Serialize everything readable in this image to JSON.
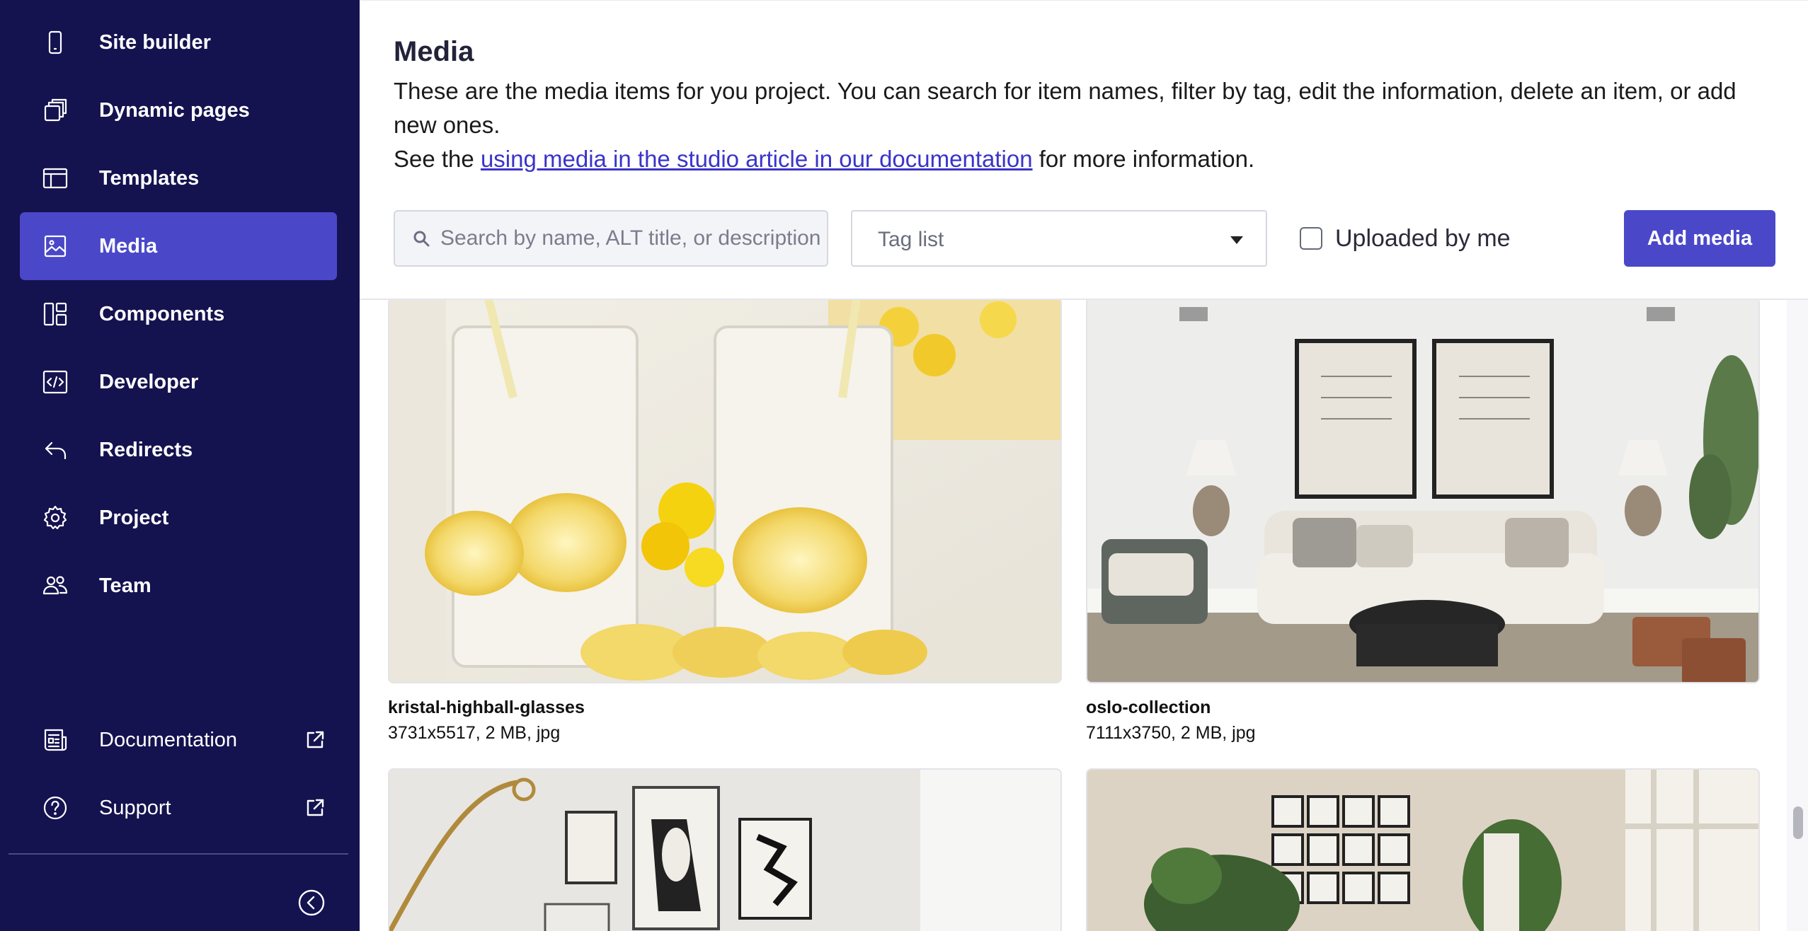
{
  "sidebar": {
    "items": [
      {
        "label": "Site builder",
        "icon": "phone-icon"
      },
      {
        "label": "Dynamic pages",
        "icon": "stacked-pages-icon"
      },
      {
        "label": "Templates",
        "icon": "template-layout-icon"
      },
      {
        "label": "Media",
        "icon": "image-icon",
        "active": true
      },
      {
        "label": "Components",
        "icon": "components-icon"
      },
      {
        "label": "Developer",
        "icon": "code-icon"
      },
      {
        "label": "Redirects",
        "icon": "redirect-arrow-icon"
      },
      {
        "label": "Project",
        "icon": "gear-icon"
      },
      {
        "label": "Team",
        "icon": "team-icon"
      }
    ],
    "footer_items": [
      {
        "label": "Documentation",
        "icon": "document-icon",
        "external": true
      },
      {
        "label": "Support",
        "icon": "help-circle-icon",
        "external": true
      }
    ],
    "collapse_icon": "chevron-left-circle-icon"
  },
  "header": {
    "title": "Media",
    "description": "These are the media items for you project. You can search for item names, filter by tag, edit the information, delete an item, or add new ones.",
    "see_prefix": "See the ",
    "doc_link": "using media in the studio article in our documentation",
    "see_suffix": " for more information."
  },
  "toolbar": {
    "search_placeholder": "Search by name, ALT title, or description",
    "tag_placeholder": "Tag list",
    "uploaded_by_me_label": "Uploaded by me",
    "uploaded_by_me_checked": false,
    "add_media_label": "Add media"
  },
  "colors": {
    "sidebar_bg": "#14124f",
    "accent": "#4a48c8",
    "link": "#3a34c9"
  },
  "media": [
    {
      "name": "kristal-highball-glasses",
      "meta": "3731x5517, 2 MB, jpg",
      "thumb": "lemonade-glasses-image"
    },
    {
      "name": "oslo-collection",
      "meta": "7111x3750, 2 MB, jpg",
      "thumb": "living-room-image"
    },
    {
      "name": "",
      "meta": "",
      "thumb": "gallery-wall-image"
    },
    {
      "name": "",
      "meta": "",
      "thumb": "plant-room-image"
    }
  ]
}
